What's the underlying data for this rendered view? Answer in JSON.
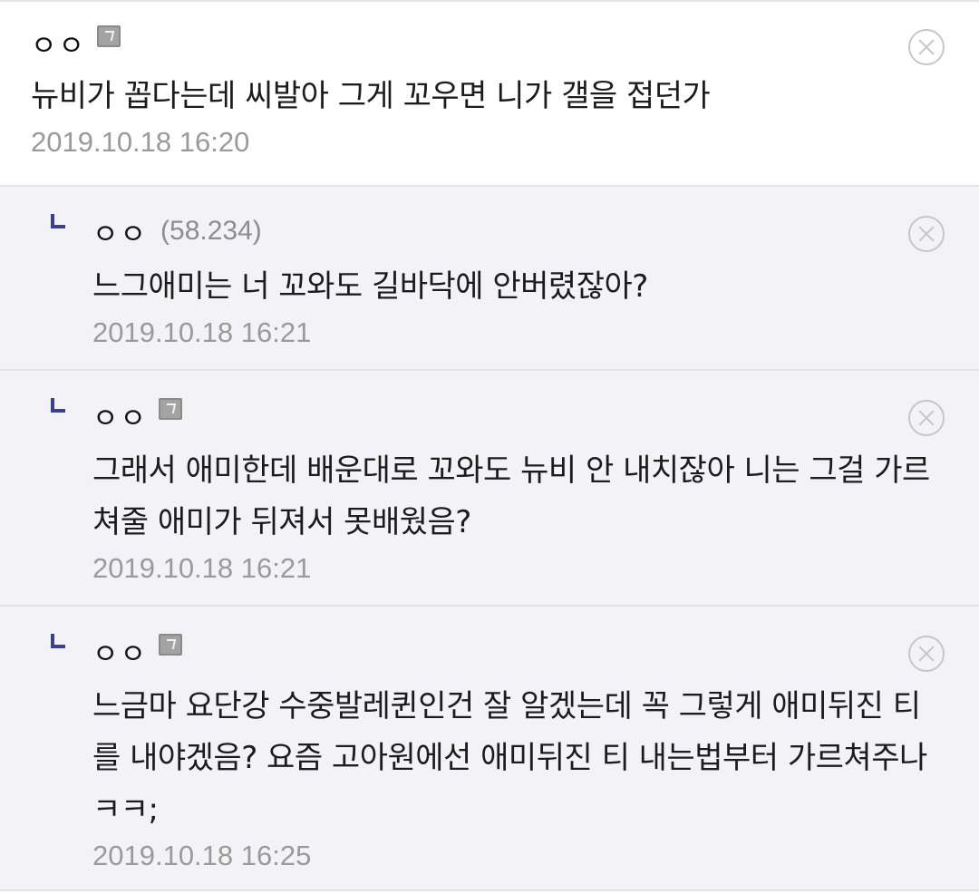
{
  "comments": [
    {
      "nick": "ㅇㅇ",
      "ip": "",
      "text": "뉴비가 꼽다는데 씨발아 그게 꼬우면 니가 갤을 접던가",
      "date": "2019.10.18 16:20"
    },
    {
      "nick": "ㅇㅇ",
      "ip": "(58.234)",
      "text": "느그애미는 너 꼬와도 길바닥에 안버렸잖아?",
      "date": "2019.10.18 16:21"
    },
    {
      "nick": "ㅇㅇ",
      "ip": "",
      "text": "그래서 애미한데 배운대로 꼬와도 뉴비 안 내치잖아 니는 그걸 가르쳐줄 애미가 뒤져서 못배웠음?",
      "date": "2019.10.18 16:21"
    },
    {
      "nick": "ㅇㅇ",
      "ip": "",
      "text": "느금마 요단강 수중발레퀸인건 잘 알겠는데 꼭 그렇게 애미뒤진 티를 내야겠음? 요즘 고아원에선 애미뒤진 티 내는법부터 가르쳐주나 ㅋㅋ;",
      "date": "2019.10.18 16:25"
    }
  ],
  "icons": {
    "fixed_user": "fixed-nick-icon",
    "delete": "close-circle-icon",
    "reply": "reply-arrow-icon"
  },
  "colors": {
    "reply_bg": "#f3f3f7",
    "reply_mark": "#3b3f8f",
    "date": "#9a9a9a"
  }
}
